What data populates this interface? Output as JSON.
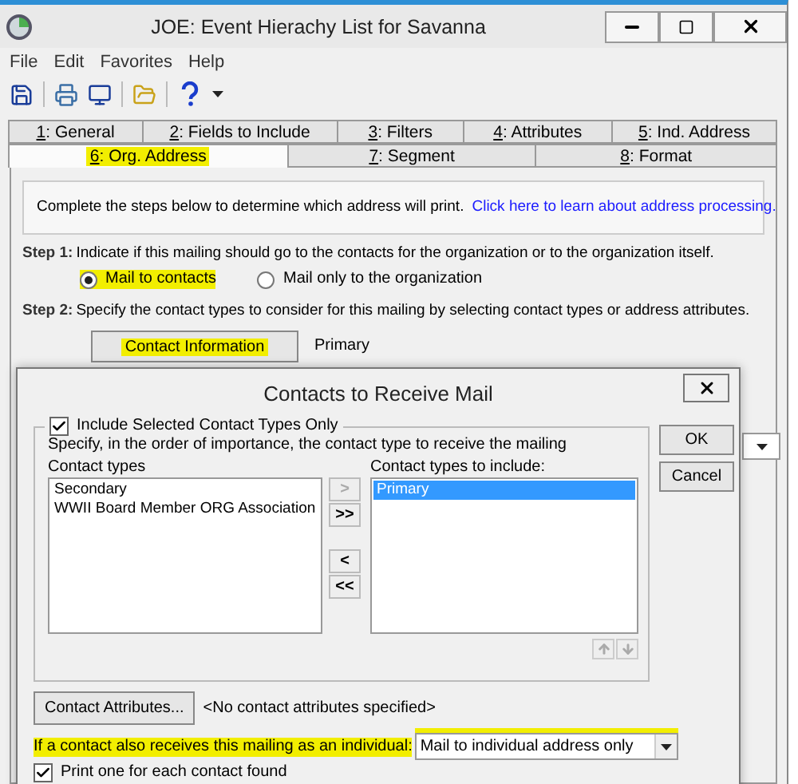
{
  "window": {
    "title": "JOE: Event Hierachy List for Savanna"
  },
  "menu": [
    "File",
    "Edit",
    "Favorites",
    "Help"
  ],
  "tabs": [
    [
      {
        "label": "1: General",
        "selected": false,
        "highlighted": false
      },
      {
        "label": "2: Fields to Include",
        "selected": false,
        "highlighted": false
      },
      {
        "label": "3: Filters",
        "selected": false,
        "highlighted": false
      },
      {
        "label": "4: Attributes",
        "selected": false,
        "highlighted": false
      },
      {
        "label": "5: Ind. Address",
        "selected": false,
        "highlighted": false
      }
    ],
    [
      {
        "label": "6: Org. Address",
        "selected": true,
        "highlighted": true
      },
      {
        "label": "7: Segment",
        "selected": false,
        "highlighted": false
      },
      {
        "label": "8: Format",
        "selected": false,
        "highlighted": false
      }
    ]
  ],
  "info": {
    "text": "Complete the steps below to determine which address will print.",
    "link": "Click here to learn about address processing."
  },
  "step1": {
    "label": "Step 1:",
    "text": "Indicate if this mailing should go to the contacts for the organization or to the organization itself.",
    "options": [
      {
        "label": "Mail to contacts",
        "selected": true,
        "highlighted": true
      },
      {
        "label": "Mail only to the organization",
        "selected": false,
        "highlighted": false
      }
    ]
  },
  "step2": {
    "label": "Step 2:",
    "text": "Specify the contact types to consider for this mailing by selecting contact types or address attributes.",
    "button": {
      "label": "Contact Information",
      "highlighted": true
    },
    "value": "Primary"
  },
  "dialog": {
    "title": "Contacts to Receive Mail",
    "include_only": {
      "label": "Include Selected Contact Types Only",
      "checked": true
    },
    "instruction": "Specify, in the order of importance, the contact type to receive the mailing",
    "available": {
      "label": "Contact types",
      "items": [
        {
          "label": "Secondary",
          "selected": false
        },
        {
          "label": "WWII Board Member ORG Association",
          "selected": false
        }
      ]
    },
    "included": {
      "label": "Contact types to include:",
      "items": [
        {
          "label": "Primary",
          "selected": true
        }
      ]
    },
    "move_buttons": [
      {
        "label": ">",
        "disabled": true
      },
      {
        "label": ">>",
        "disabled": false
      },
      {
        "label": "<",
        "disabled": false
      },
      {
        "label": "<<",
        "disabled": false
      }
    ],
    "attributes_button": "Contact Attributes...",
    "attributes_text": "<No contact attributes specified>",
    "individual": {
      "label": "If a contact also receives this mailing as an individual:",
      "value": "Mail to individual address only",
      "highlighted": true
    },
    "print_one": {
      "label": "Print one for each contact found",
      "checked": true
    },
    "buttons": [
      "OK",
      "Cancel"
    ]
  }
}
